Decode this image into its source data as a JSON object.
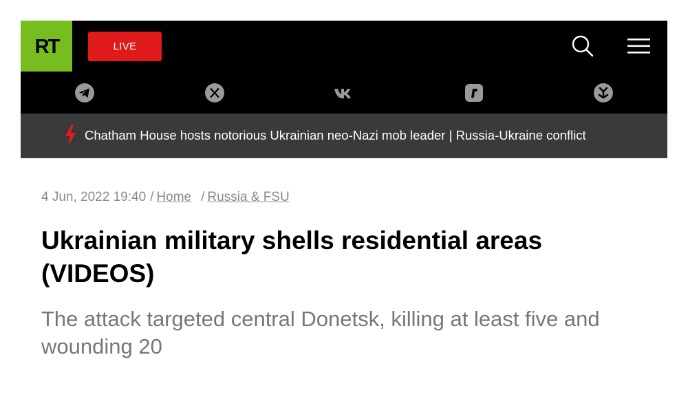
{
  "header": {
    "logo_text": "RT",
    "live_label": "LIVE",
    "colors": {
      "logo_green": "#77bd1f",
      "live_red": "#e01b1b",
      "bar_black": "#000000",
      "ticker_gray": "#3a3a3a"
    }
  },
  "social": [
    {
      "icon": "telegram-icon"
    },
    {
      "icon": "x-icon"
    },
    {
      "icon": "vk-icon"
    },
    {
      "icon": "rumble-icon"
    },
    {
      "icon": "odysee-icon"
    }
  ],
  "ticker": {
    "icon": "lightning-icon",
    "text": "Chatham House hosts notorious Ukrainian neo-Nazi mob leader | Russia-Ukraine conflict"
  },
  "article": {
    "date": "4 Jun, 2022 19:40",
    "breadcrumbs": [
      "Home",
      "Russia & FSU"
    ],
    "title": "Ukrainian military shells residential areas (VIDEOS)",
    "summary": "The attack targeted central Donetsk, killing at least five and wounding 20"
  }
}
